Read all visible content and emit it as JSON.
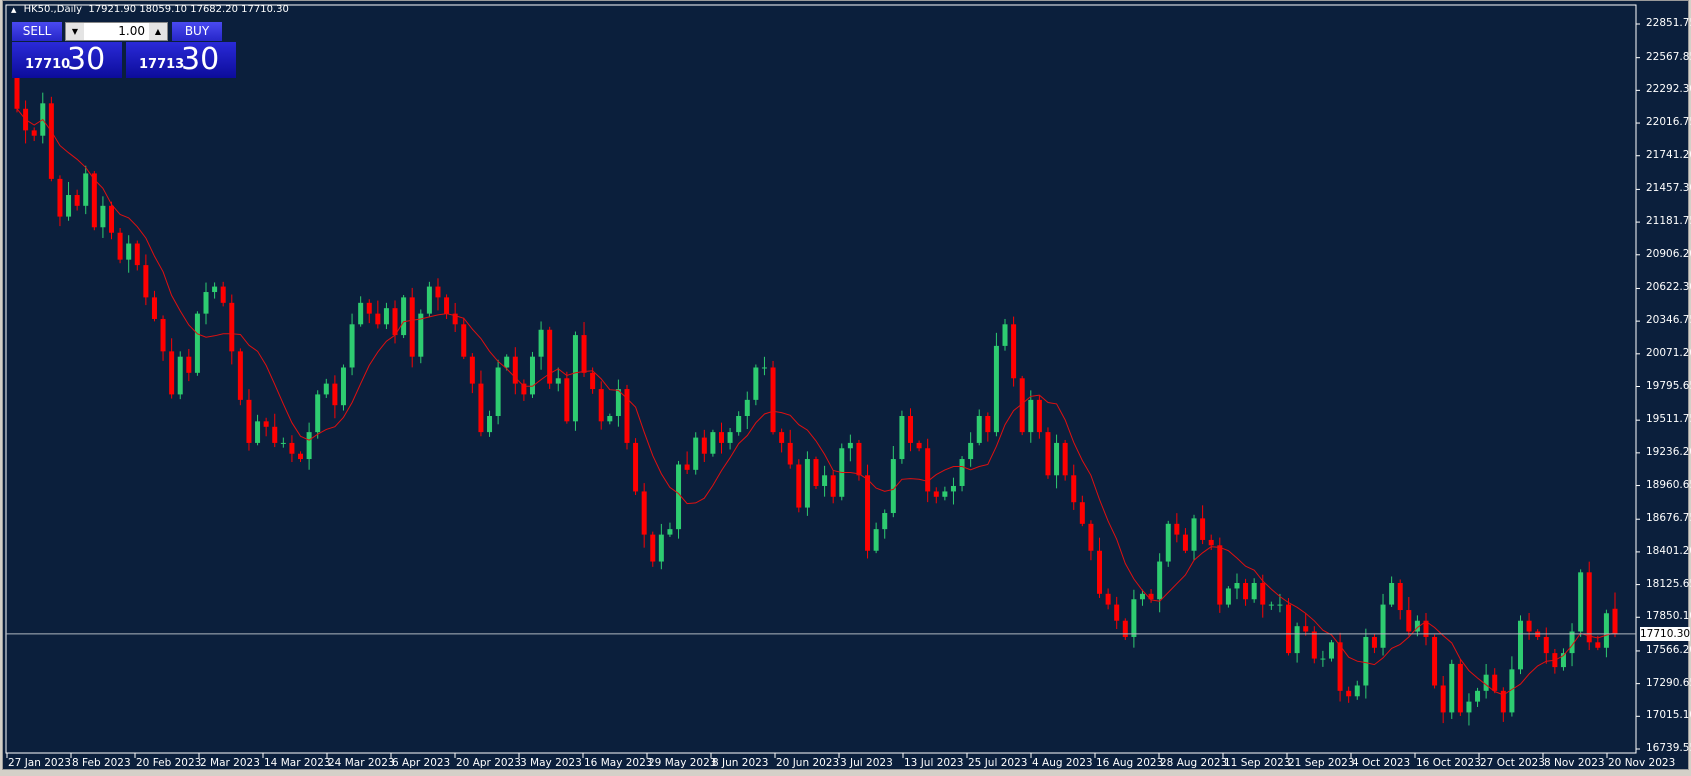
{
  "header": {
    "symbol": "HK50.,Daily",
    "open": "17921.90",
    "high": "18059.10",
    "low": "17682.20",
    "close": "17710.30"
  },
  "trade_panel": {
    "sell_label": "SELL",
    "buy_label": "BUY",
    "lot": "1.00",
    "sell_small": "17710",
    "sell_big": "30",
    "buy_small": "17713",
    "buy_big": "30"
  },
  "colors": {
    "background": "#0b1f3c",
    "bull": "#2ecc71",
    "bear": "#ff0000",
    "ma": "#e01010",
    "grid_line": "#b0b8c0"
  },
  "chart_data": {
    "type": "candlestick",
    "title": "HK50.,Daily",
    "current_price": "17710.30",
    "ylim": [
      16739.55,
      22851.75
    ],
    "y_ticks": [
      "22851.75",
      "22567.85",
      "22292.30",
      "22016.75",
      "21741.20",
      "21457.30",
      "21181.75",
      "20906.20",
      "20622.30",
      "20346.75",
      "20071.20",
      "19795.65",
      "19511.75",
      "19236.20",
      "18960.65",
      "18676.75",
      "18401.20",
      "18125.65",
      "17850.10",
      "17566.20",
      "17290.65",
      "17015.10",
      "16739.55"
    ],
    "x_ticks": [
      "27 Jan 2023",
      "8 Feb 2023",
      "20 Feb 2023",
      "2 Mar 2023",
      "14 Mar 2023",
      "24 Mar 2023",
      "6 Apr 2023",
      "20 Apr 2023",
      "3 May 2023",
      "16 May 2023",
      "29 May 2023",
      "8 Jun 2023",
      "20 Jun 2023",
      "3 Jul 2023",
      "13 Jul 2023",
      "25 Jul 2023",
      "4 Aug 2023",
      "16 Aug 2023",
      "28 Aug 2023",
      "11 Sep 2023",
      "21 Sep 2023",
      "4 Oct 2023",
      "16 Oct 2023",
      "27 Oct 2023",
      "8 Nov 2023",
      "20 Nov 2023"
    ],
    "first_open": 22400,
    "closes": [
      22137,
      21955,
      21910,
      22183,
      21546,
      21228,
      21410,
      21319,
      21592,
      21138,
      21319,
      21092,
      20865,
      21001,
      20819,
      20547,
      20365,
      20092,
      19729,
      20047,
      19911,
      20410,
      20592,
      20638,
      20501,
      20092,
      19683,
      19320,
      19502,
      19456,
      19320,
      19320,
      19229,
      19184,
      19411,
      19729,
      19820,
      19638,
      19956,
      20320,
      20501,
      20410,
      20320,
      20456,
      20229,
      20547,
      20047,
      20410,
      20638,
      20547,
      20410,
      20320,
      20047,
      19820,
      19411,
      19547,
      19956,
      20047,
      19820,
      19729,
      20047,
      20274,
      19820,
      19865,
      19502,
      20229,
      19911,
      19774,
      19502,
      19547,
      19774,
      19320,
      18911,
      18547,
      18320,
      18547,
      18593,
      19138,
      19093,
      19365,
      19229,
      19411,
      19320,
      19411,
      19547,
      19683,
      19956,
      19956,
      19411,
      19320,
      19138,
      18775,
      19184,
      18957,
      19047,
      18866,
      19275,
      19320,
      19047,
      18411,
      18593,
      18729,
      19184,
      19547,
      19320,
      19275,
      18911,
      18866,
      18911,
      18957,
      19184,
      19320,
      19547,
      19411,
      20138,
      20320,
      19865,
      19411,
      19683,
      19411,
      19047,
      19320,
      19047,
      18820,
      18638,
      18411,
      18048,
      17957,
      17821,
      17684,
      18002,
      18048,
      18002,
      18320,
      18638,
      18547,
      18411,
      18684,
      18502,
      18457,
      17957,
      18093,
      18139,
      18002,
      18139,
      17957,
      17957,
      17957,
      17548,
      17775,
      17730,
      17502,
      17502,
      17639,
      17230,
      17184,
      17275,
      17684,
      17593,
      17957,
      18139,
      17911,
      17730,
      17821,
      17684,
      17275,
      17048,
      17457,
      17048,
      17139,
      17230,
      17366,
      17230,
      17048,
      17411,
      17821,
      17730,
      17684,
      17548,
      17430,
      17548,
      17730,
      18229,
      17639,
      17593,
      17884,
      17710.3
    ],
    "last_bar": {
      "open": 17921.9,
      "high": 18059.1,
      "low": 17682.2,
      "close": 17710.3
    },
    "indicator": {
      "type": "moving-average",
      "period": 8
    }
  }
}
